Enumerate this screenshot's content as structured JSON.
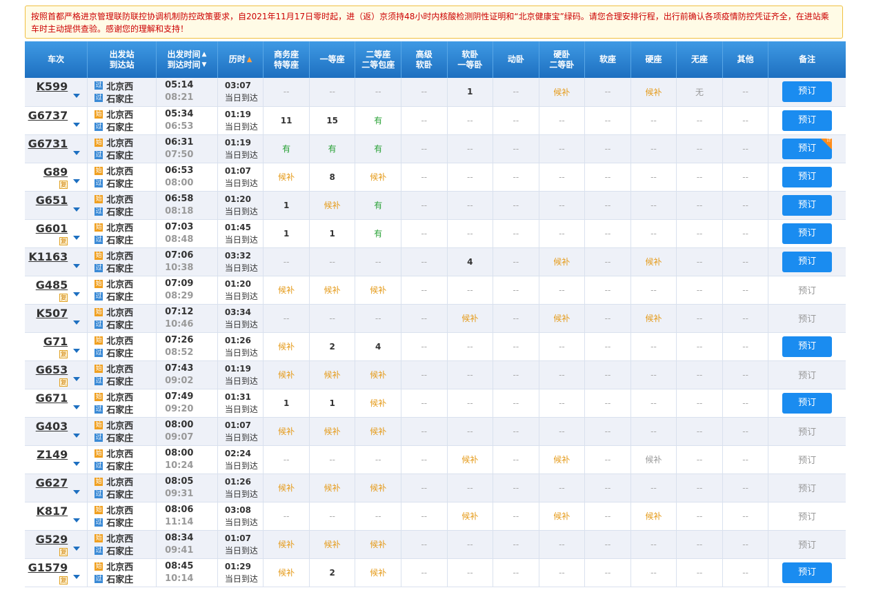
{
  "notice": "按照首都严格进京管理联防联控协调机制防控政策要求，自2021年11月17日零时起，进（返）京须持48小时内核酸检测阴性证明和“北京健康宝”绿码。请您合理安排行程，出行前确认各项疫情防控凭证齐全，在进站乘车时主动提供查验。感谢您的理解和支持！",
  "headers": {
    "train": "车次",
    "station1": "出发站",
    "station2": "到达站",
    "time1": "出发时间",
    "time2": "到达时间",
    "duration": "历时",
    "business1": "商务座",
    "business2": "特等座",
    "first": "一等座",
    "second1": "二等座",
    "second2": "二等包座",
    "premium1": "高级",
    "premium2": "软卧",
    "softsleeper1": "软卧",
    "softsleeper2": "一等卧",
    "dongwo": "动卧",
    "hardsleeper1": "硬卧",
    "hardsleeper2": "二等卧",
    "softseat": "软座",
    "hardseat": "硬座",
    "noseat": "无座",
    "other": "其他",
    "remark": "备注"
  },
  "labels": {
    "start_badge": "始",
    "pass_badge": "过",
    "fu_badge": "复",
    "same_day": "当日到达",
    "book": "预订",
    "corner": "计"
  },
  "colors": {
    "header": "#1d6fc0",
    "book_button": "#1a8cf0",
    "available": "#26a033",
    "waitlist": "#e59b1a",
    "notice_text": "#cc0000"
  },
  "rows": [
    {
      "train": "K599",
      "fu": false,
      "from": "北京西",
      "from_type": "过",
      "to": "石家庄",
      "dep": "05:14",
      "arr": "08:21",
      "dur": "03:07",
      "seats": [
        "--",
        "--",
        "--",
        "--",
        "1",
        "--",
        "候补",
        "--",
        "候补",
        "无",
        "--"
      ],
      "book": "active",
      "corner": false
    },
    {
      "train": "G6737",
      "fu": false,
      "from": "北京西",
      "from_type": "始",
      "to": "石家庄",
      "dep": "05:34",
      "arr": "06:53",
      "dur": "01:19",
      "seats": [
        "11",
        "15",
        "有",
        "--",
        "--",
        "--",
        "--",
        "--",
        "--",
        "--",
        "--"
      ],
      "book": "active",
      "corner": false
    },
    {
      "train": "G6731",
      "fu": false,
      "from": "北京西",
      "from_type": "始",
      "to": "石家庄",
      "dep": "06:31",
      "arr": "07:50",
      "dur": "01:19",
      "seats": [
        "有",
        "有",
        "有",
        "--",
        "--",
        "--",
        "--",
        "--",
        "--",
        "--",
        "--"
      ],
      "book": "active",
      "corner": true
    },
    {
      "train": "G89",
      "fu": true,
      "from": "北京西",
      "from_type": "始",
      "to": "石家庄",
      "dep": "06:53",
      "arr": "08:00",
      "dur": "01:07",
      "seats": [
        "候补",
        "8",
        "候补",
        "--",
        "--",
        "--",
        "--",
        "--",
        "--",
        "--",
        "--"
      ],
      "book": "active",
      "corner": false
    },
    {
      "train": "G651",
      "fu": false,
      "from": "北京西",
      "from_type": "始",
      "to": "石家庄",
      "dep": "06:58",
      "arr": "08:18",
      "dur": "01:20",
      "seats": [
        "1",
        "候补",
        "有",
        "--",
        "--",
        "--",
        "--",
        "--",
        "--",
        "--",
        "--"
      ],
      "book": "active",
      "corner": false
    },
    {
      "train": "G601",
      "fu": true,
      "from": "北京西",
      "from_type": "始",
      "to": "石家庄",
      "dep": "07:03",
      "arr": "08:48",
      "dur": "01:45",
      "seats": [
        "1",
        "1",
        "有",
        "--",
        "--",
        "--",
        "--",
        "--",
        "--",
        "--",
        "--"
      ],
      "book": "active",
      "corner": false
    },
    {
      "train": "K1163",
      "fu": false,
      "from": "北京西",
      "from_type": "始",
      "to": "石家庄",
      "dep": "07:06",
      "arr": "10:38",
      "dur": "03:32",
      "seats": [
        "--",
        "--",
        "--",
        "--",
        "4",
        "--",
        "候补",
        "--",
        "候补",
        "--",
        "--"
      ],
      "book": "active",
      "corner": false
    },
    {
      "train": "G485",
      "fu": true,
      "from": "北京西",
      "from_type": "始",
      "to": "石家庄",
      "dep": "07:09",
      "arr": "08:29",
      "dur": "01:20",
      "seats": [
        "候补",
        "候补",
        "候补",
        "--",
        "--",
        "--",
        "--",
        "--",
        "--",
        "--",
        "--"
      ],
      "book": "disabled",
      "corner": false
    },
    {
      "train": "K507",
      "fu": false,
      "from": "北京西",
      "from_type": "始",
      "to": "石家庄",
      "dep": "07:12",
      "arr": "10:46",
      "dur": "03:34",
      "seats": [
        "--",
        "--",
        "--",
        "--",
        "候补",
        "--",
        "候补",
        "--",
        "候补",
        "--",
        "--"
      ],
      "book": "disabled",
      "corner": false
    },
    {
      "train": "G71",
      "fu": true,
      "from": "北京西",
      "from_type": "始",
      "to": "石家庄",
      "dep": "07:26",
      "arr": "08:52",
      "dur": "01:26",
      "seats": [
        "候补",
        "2",
        "4",
        "--",
        "--",
        "--",
        "--",
        "--",
        "--",
        "--",
        "--"
      ],
      "book": "active",
      "corner": false
    },
    {
      "train": "G653",
      "fu": true,
      "from": "北京西",
      "from_type": "始",
      "to": "石家庄",
      "dep": "07:43",
      "arr": "09:02",
      "dur": "01:19",
      "seats": [
        "候补",
        "候补",
        "候补",
        "--",
        "--",
        "--",
        "--",
        "--",
        "--",
        "--",
        "--"
      ],
      "book": "disabled",
      "corner": false
    },
    {
      "train": "G671",
      "fu": false,
      "from": "北京西",
      "from_type": "始",
      "to": "石家庄",
      "dep": "07:49",
      "arr": "09:20",
      "dur": "01:31",
      "seats": [
        "1",
        "1",
        "候补",
        "--",
        "--",
        "--",
        "--",
        "--",
        "--",
        "--",
        "--"
      ],
      "book": "active",
      "corner": false
    },
    {
      "train": "G403",
      "fu": false,
      "from": "北京西",
      "from_type": "始",
      "to": "石家庄",
      "dep": "08:00",
      "arr": "09:07",
      "dur": "01:07",
      "seats": [
        "候补",
        "候补",
        "候补",
        "--",
        "--",
        "--",
        "--",
        "--",
        "--",
        "--",
        "--"
      ],
      "book": "disabled",
      "corner": false
    },
    {
      "train": "Z149",
      "fu": false,
      "from": "北京西",
      "from_type": "始",
      "to": "石家庄",
      "dep": "08:00",
      "arr": "10:24",
      "dur": "02:24",
      "seats": [
        "--",
        "--",
        "--",
        "--",
        "候补",
        "--",
        "候补",
        "--",
        "候补*",
        "--",
        "--"
      ],
      "book": "disabled",
      "corner": false
    },
    {
      "train": "G627",
      "fu": false,
      "from": "北京西",
      "from_type": "始",
      "to": "石家庄",
      "dep": "08:05",
      "arr": "09:31",
      "dur": "01:26",
      "seats": [
        "候补",
        "候补",
        "候补",
        "--",
        "--",
        "--",
        "--",
        "--",
        "--",
        "--",
        "--"
      ],
      "book": "disabled",
      "corner": false
    },
    {
      "train": "K817",
      "fu": false,
      "from": "北京西",
      "from_type": "始",
      "to": "石家庄",
      "dep": "08:06",
      "arr": "11:14",
      "dur": "03:08",
      "seats": [
        "--",
        "--",
        "--",
        "--",
        "候补",
        "--",
        "候补",
        "--",
        "候补",
        "--",
        "--"
      ],
      "book": "disabled",
      "corner": false
    },
    {
      "train": "G529",
      "fu": true,
      "from": "北京西",
      "from_type": "始",
      "to": "石家庄",
      "dep": "08:34",
      "arr": "09:41",
      "dur": "01:07",
      "seats": [
        "候补",
        "候补",
        "候补",
        "--",
        "--",
        "--",
        "--",
        "--",
        "--",
        "--",
        "--"
      ],
      "book": "disabled",
      "corner": false
    },
    {
      "train": "G1579",
      "fu": true,
      "from": "北京西",
      "from_type": "始",
      "to": "石家庄",
      "dep": "08:45",
      "arr": "10:14",
      "dur": "01:29",
      "seats": [
        "候补",
        "2",
        "候补",
        "--",
        "--",
        "--",
        "--",
        "--",
        "--",
        "--",
        "--"
      ],
      "book": "active",
      "corner": false
    }
  ]
}
